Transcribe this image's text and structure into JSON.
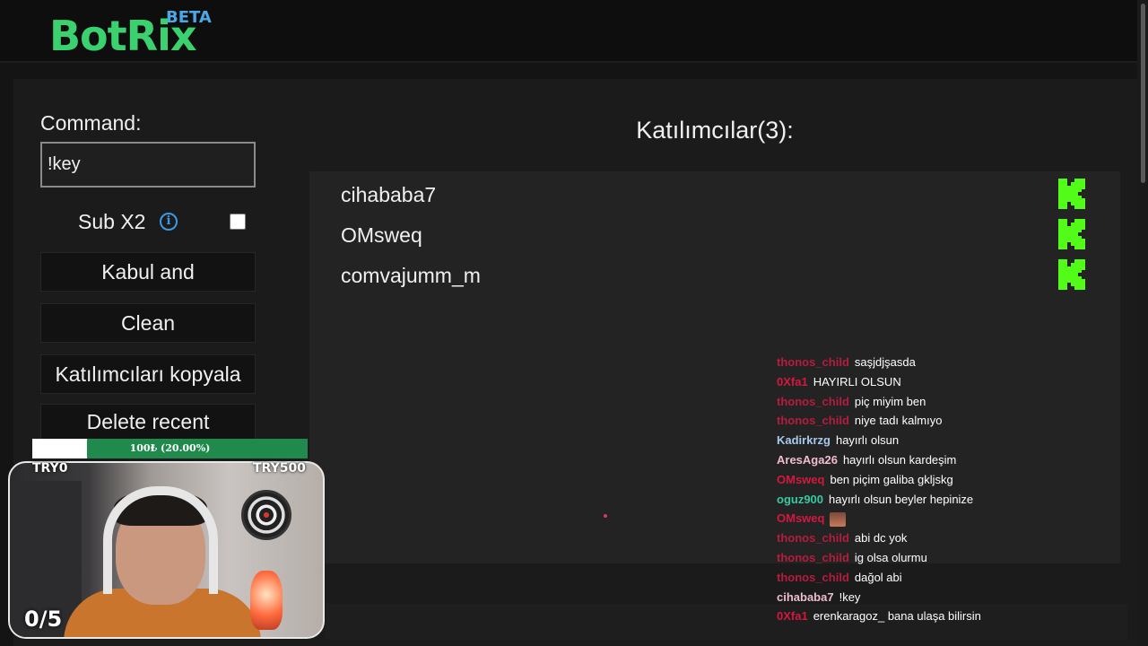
{
  "app": {
    "logo_text": "BotRix",
    "beta_text": "BETA"
  },
  "sidebar": {
    "command_label": "Command:",
    "command_value": "!key",
    "sub_label": "Sub X2",
    "info_icon": "info-icon",
    "sub_checked": false,
    "buttons": {
      "accept": "Kabul and",
      "clean": "Clean",
      "copy": "Katılımcıları kopyala",
      "delete": "Delete recent"
    }
  },
  "overlay": {
    "progress_text": "100₺ (20.00%)",
    "progress_fraction": 0.2,
    "try_left": "TRY0",
    "try_right": "TRY500",
    "counter": "0/5"
  },
  "participants": {
    "title": "Katılımcılar(3):",
    "platform_icon": "kick-icon",
    "list": [
      "cihababa7",
      "OMsweq",
      "comvajumm_m"
    ]
  },
  "chat": [
    {
      "user": "thonos_child",
      "msg": "saşjdjşasda"
    },
    {
      "user": "0Xfa1",
      "msg": "HAYIRLI OLSUN"
    },
    {
      "user": "thonos_child",
      "msg": "piç miyim ben"
    },
    {
      "user": "thonos_child",
      "msg": "niye tadı kalmıyo"
    },
    {
      "user": "Kadirkrzg",
      "msg": "hayırlı olsun"
    },
    {
      "user": "AresAga26",
      "msg": "hayırlı olsun kardeşim"
    },
    {
      "user": "OMsweq",
      "msg": "ben piçim galiba gkljskg"
    },
    {
      "user": "oguz900",
      "msg": "hayırlı olsun beyler hepinize"
    },
    {
      "user": "OMsweq",
      "msg": "",
      "emote": "emote-icon"
    },
    {
      "user": "thonos_child",
      "msg": "abi dc yok"
    },
    {
      "user": "thonos_child",
      "msg": "ig olsa olurmu"
    },
    {
      "user": "thonos_child",
      "msg": "dağol abi"
    },
    {
      "user": "cihababa7",
      "msg": "!key"
    },
    {
      "user": "0Xfa1",
      "msg": "erenkaragoz_ bana ulaşa bilirsin"
    }
  ]
}
